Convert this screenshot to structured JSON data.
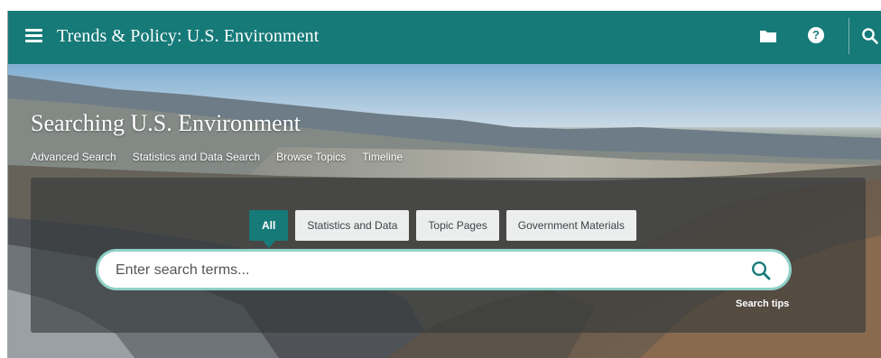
{
  "header": {
    "title": "Trends & Policy: U.S. Environment",
    "menu_icon": "menu-icon",
    "folder_icon": "folder-icon",
    "help_icon": "help-icon",
    "help_glyph": "?",
    "search_icon": "search-icon",
    "color": "#167a78"
  },
  "hero": {
    "heading": "Searching U.S. Environment",
    "links": [
      "Advanced Search",
      "Statistics and Data Search",
      "Browse Topics",
      "Timeline"
    ]
  },
  "search": {
    "filters": [
      "All",
      "Statistics and Data",
      "Topic Pages",
      "Government Materials"
    ],
    "active_filter": "All",
    "placeholder": "Enter search terms...",
    "value": "",
    "tips_label": "Search tips",
    "focus_color": "#8fd0c7"
  }
}
